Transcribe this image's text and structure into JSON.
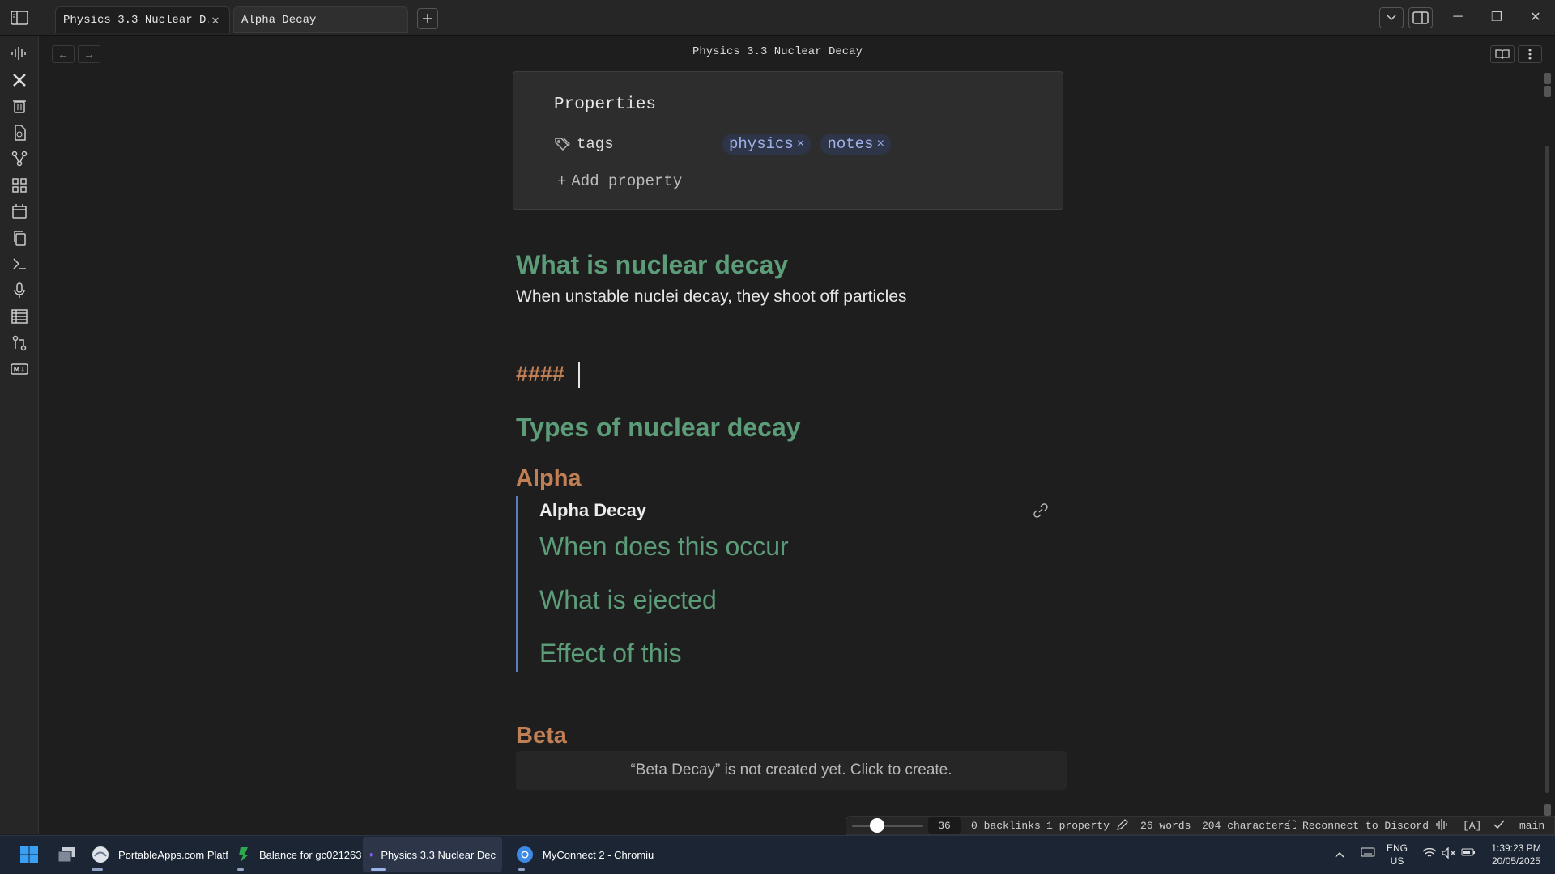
{
  "tabs": [
    {
      "label": "Physics 3.3 Nuclear D..."
    },
    {
      "label": "Alpha Decay"
    }
  ],
  "header": {
    "title": "Physics 3.3 Nuclear Decay"
  },
  "properties": {
    "title": "Properties",
    "tags_key": "tags",
    "tags": [
      "physics",
      "notes"
    ],
    "add_label": "Add property"
  },
  "note": {
    "h1": "What is nuclear decay",
    "p1": "When unstable nuclei decay, they shoot off particles",
    "hashes": "####",
    "h2": "Types of nuclear decay",
    "alpha": "Alpha",
    "embed": {
      "title": "Alpha Decay",
      "headings": [
        "When does this occur",
        "What is ejected",
        "Effect of this"
      ]
    },
    "beta": "Beta",
    "beta_missing": "“Beta Decay” is not created yet. Click to create."
  },
  "status": {
    "zoom": "36",
    "backlinks": "0 backlinks",
    "properties": "1 property",
    "words": "26 words",
    "chars": "204 characters",
    "discord": "Reconnect to Discord",
    "vim": "[A]",
    "branch": "main"
  },
  "taskbar": {
    "apps": [
      {
        "label": "PortableApps.com Platf"
      },
      {
        "label": "Balance for gc021263"
      },
      {
        "label": "Physics 3.3 Nuclear Dec"
      },
      {
        "label": "MyConnect 2 - Chromiu"
      }
    ],
    "lang": "ENG",
    "region": "US",
    "time": "1:39:23 PM",
    "date": "20/05/2025"
  },
  "colors": {
    "heading_green": "#5c9c78",
    "heading_orange": "#c07f54",
    "tag_blue": "#9fb2e8",
    "embed_border": "#5a7cc0"
  }
}
